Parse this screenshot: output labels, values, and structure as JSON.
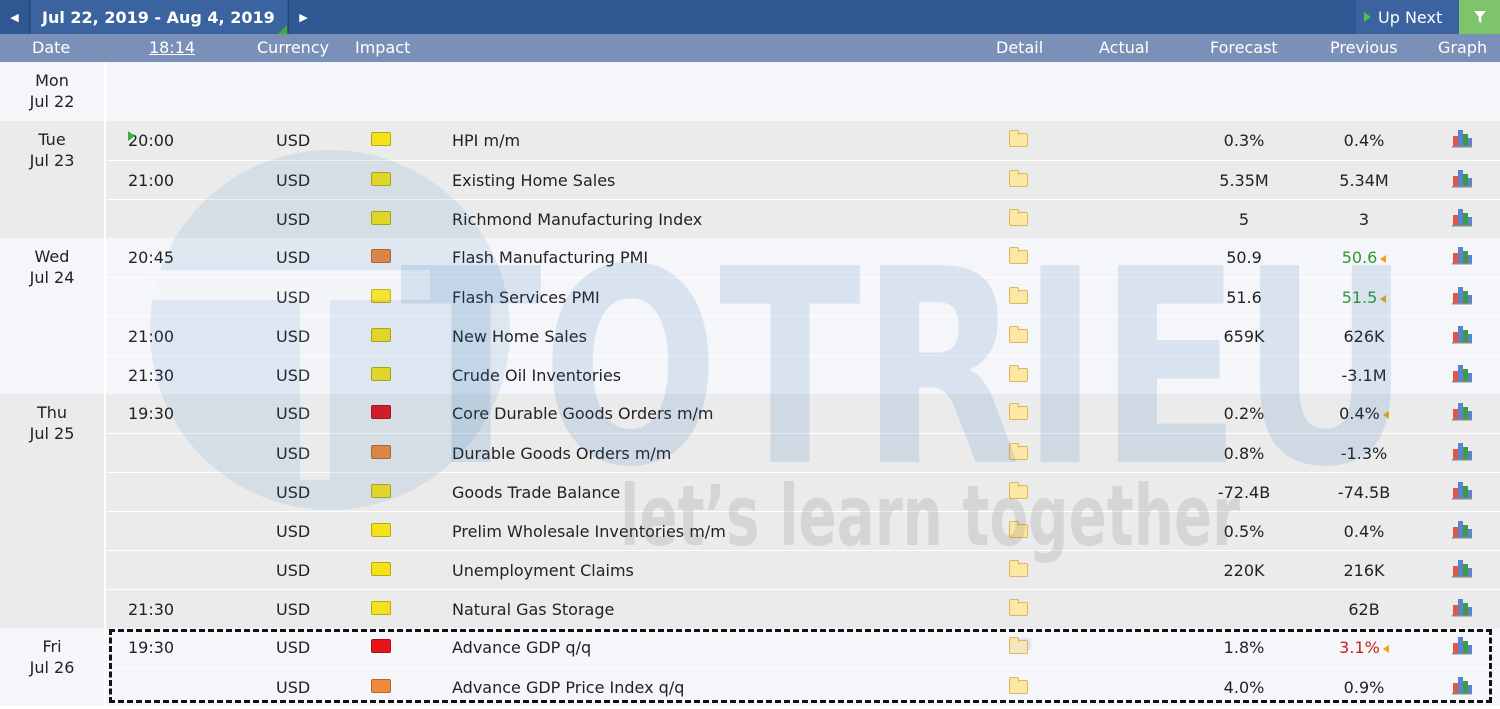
{
  "nav": {
    "date_range": "Jul 22, 2019 - Aug 4, 2019",
    "up_next": "Up Next",
    "prev_icon": "triangle-left-icon",
    "next_icon": "triangle-right-icon",
    "filter_icon": "filter-funnel-icon"
  },
  "headers": {
    "date": "Date",
    "time": "18:14",
    "currency": "Currency",
    "impact": "Impact",
    "detail": "Detail",
    "actual": "Actual",
    "forecast": "Forecast",
    "previous": "Previous",
    "graph": "Graph"
  },
  "watermark": {
    "brand": "TOTRIEU",
    "tagline": "let’s learn together"
  },
  "colors": {
    "nav_bg": "#2f5792",
    "header_bg": "#7a90b8",
    "impact_low": "#f6e21b",
    "impact_medium": "#ef8a3c",
    "impact_high": "#e5141b",
    "better": "#2e9a2e",
    "worse": "#cc1f1f"
  },
  "days": [
    {
      "dow": "Mon",
      "date": "Jul 22",
      "events": []
    },
    {
      "dow": "Tue",
      "date": "Jul 23",
      "events": [
        {
          "time": "20:00",
          "next": true,
          "currency": "USD",
          "impact": "low",
          "title": "HPI m/m",
          "actual": "",
          "forecast": "0.3%",
          "previous": "0.4%"
        },
        {
          "time": "21:00",
          "currency": "USD",
          "impact": "low",
          "title": "Existing Home Sales",
          "actual": "",
          "forecast": "5.35M",
          "previous": "5.34M"
        },
        {
          "time": "",
          "currency": "USD",
          "impact": "low",
          "title": "Richmond Manufacturing Index",
          "actual": "",
          "forecast": "5",
          "previous": "3"
        }
      ]
    },
    {
      "dow": "Wed",
      "date": "Jul 24",
      "events": [
        {
          "time": "20:45",
          "currency": "USD",
          "impact": "medium",
          "title": "Flash Manufacturing PMI",
          "actual": "",
          "forecast": "50.9",
          "previous": "50.6",
          "previous_class": "better",
          "revised": true
        },
        {
          "time": "",
          "currency": "USD",
          "impact": "low",
          "title": "Flash Services PMI",
          "actual": "",
          "forecast": "51.6",
          "previous": "51.5",
          "previous_class": "better",
          "revised": true
        },
        {
          "time": "21:00",
          "currency": "USD",
          "impact": "low",
          "title": "New Home Sales",
          "actual": "",
          "forecast": "659K",
          "previous": "626K"
        },
        {
          "time": "21:30",
          "currency": "USD",
          "impact": "low",
          "title": "Crude Oil Inventories",
          "actual": "",
          "forecast": "",
          "previous": "-3.1M"
        }
      ]
    },
    {
      "dow": "Thu",
      "date": "Jul 25",
      "events": [
        {
          "time": "19:30",
          "currency": "USD",
          "impact": "high",
          "title": "Core Durable Goods Orders m/m",
          "actual": "",
          "forecast": "0.2%",
          "previous": "0.4%",
          "revised": true
        },
        {
          "time": "",
          "currency": "USD",
          "impact": "medium",
          "title": "Durable Goods Orders m/m",
          "actual": "",
          "forecast": "0.8%",
          "previous": "-1.3%"
        },
        {
          "time": "",
          "currency": "USD",
          "impact": "low",
          "title": "Goods Trade Balance",
          "actual": "",
          "forecast": "-72.4B",
          "previous": "-74.5B"
        },
        {
          "time": "",
          "currency": "USD",
          "impact": "low",
          "title": "Prelim Wholesale Inventories m/m",
          "actual": "",
          "forecast": "0.5%",
          "previous": "0.4%"
        },
        {
          "time": "",
          "currency": "USD",
          "impact": "low",
          "title": "Unemployment Claims",
          "actual": "",
          "forecast": "220K",
          "previous": "216K"
        },
        {
          "time": "21:30",
          "currency": "USD",
          "impact": "low",
          "title": "Natural Gas Storage",
          "actual": "",
          "forecast": "",
          "previous": "62B"
        }
      ]
    },
    {
      "dow": "Fri",
      "date": "Jul 26",
      "events": [
        {
          "time": "19:30",
          "currency": "USD",
          "impact": "high",
          "title": "Advance GDP q/q",
          "actual": "",
          "forecast": "1.8%",
          "previous": "3.1%",
          "previous_class": "worse",
          "revised": true,
          "detail_doc": true
        },
        {
          "time": "",
          "currency": "USD",
          "impact": "medium",
          "title": "Advance GDP Price Index q/q",
          "actual": "",
          "forecast": "4.0%",
          "previous": "0.9%"
        }
      ]
    }
  ]
}
